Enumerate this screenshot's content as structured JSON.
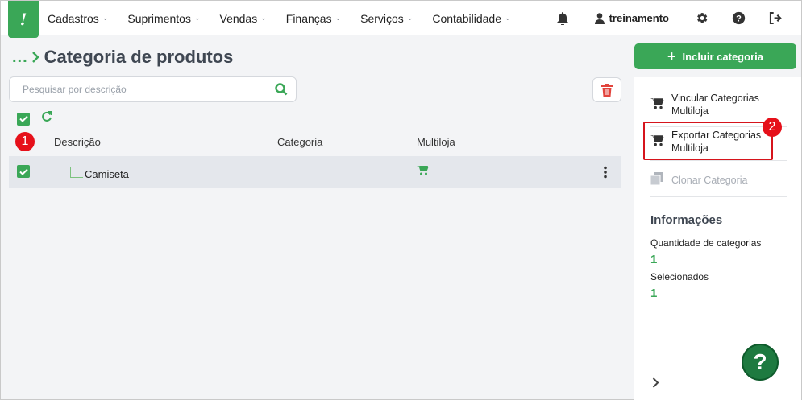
{
  "logo": {
    "text": "!"
  },
  "menu": [
    {
      "label": "Cadastros"
    },
    {
      "label": "Suprimentos"
    },
    {
      "label": "Vendas"
    },
    {
      "label": "Finanças"
    },
    {
      "label": "Serviços"
    },
    {
      "label": "Contabilidade"
    }
  ],
  "user": {
    "name": "treinamento"
  },
  "page": {
    "breadcrumb": "...",
    "title": "Categoria de produtos"
  },
  "search": {
    "placeholder": "Pesquisar por descrição",
    "value": ""
  },
  "table": {
    "columns": {
      "descricao": "Descrição",
      "categoria": "Categoria",
      "multiloja": "Multiloja"
    },
    "rows": [
      {
        "descricao": "Camiseta",
        "categoria": "",
        "multiloja_icon": "cart-icon"
      }
    ]
  },
  "annotations": {
    "badge1": "1",
    "badge2": "2"
  },
  "sidebar": {
    "include_button": "Incluir categoria",
    "actions": [
      {
        "label_line1": "Vincular Categorias",
        "label_line2": "Multiloja"
      },
      {
        "label_line1": "Exportar Categorias",
        "label_line2": "Multiloja"
      },
      {
        "label_line1": "Clonar Categoria",
        "label_line2": ""
      }
    ],
    "info": {
      "title": "Informações",
      "qty_label": "Quantidade de categorias",
      "qty_value": "1",
      "selected_label": "Selecionados",
      "selected_value": "1"
    },
    "help_label": "?",
    "collapse_label": "›"
  },
  "colors": {
    "accent": "#3aa757",
    "danger": "#e6101a",
    "highlight": "#d6141c"
  }
}
